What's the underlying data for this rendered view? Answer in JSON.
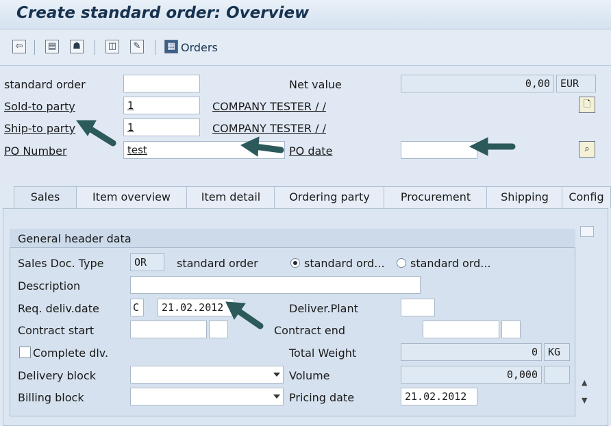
{
  "title": "Create standard order: Overview",
  "toolbar": {
    "icons": [
      "display-doc-icon",
      "header-icon",
      "partner-icon",
      "item-icon",
      "configure-icon",
      "orders-grid-icon"
    ],
    "orders_label": "Orders"
  },
  "header": {
    "standard_order_label": "standard order",
    "standard_order_value": "",
    "net_value_label": "Net value",
    "net_value": "0,00",
    "currency": "EUR",
    "sold_to_label": "Sold-to party",
    "sold_to_value": "1",
    "sold_to_name": "COMPANY TESTER / /",
    "ship_to_label": "Ship-to party",
    "ship_to_value": "1",
    "ship_to_name": "COMPANY TESTER / /",
    "po_number_label": "PO Number",
    "po_number_value": "test",
    "po_date_label": "PO date",
    "po_date_value": ""
  },
  "tabs": [
    {
      "label": "Sales",
      "active": true
    },
    {
      "label": "Item overview"
    },
    {
      "label": "Item detail"
    },
    {
      "label": "Ordering party"
    },
    {
      "label": "Procurement"
    },
    {
      "label": "Shipping"
    },
    {
      "label": "Config"
    }
  ],
  "sales": {
    "group_title": "General header data",
    "doc_type_label": "Sales Doc. Type",
    "doc_type_value": "OR",
    "doc_type_text": "standard order",
    "radio1_label": "standard ord...",
    "radio2_label": "standard ord...",
    "description_label": "Description",
    "description_value": "",
    "req_deliv_label": "Req. deliv.date",
    "req_deliv_prefix": "C",
    "req_deliv_value": "21.02.2012",
    "deliver_plant_label": "Deliver.Plant",
    "deliver_plant_value": "",
    "contract_start_label": "Contract start",
    "contract_end_label": "Contract end",
    "complete_dlv_label": "Complete dlv.",
    "total_weight_label": "Total Weight",
    "total_weight_value": "0",
    "weight_unit": "KG",
    "delivery_block_label": "Delivery block",
    "volume_label": "Volume",
    "volume_value": "0,000",
    "billing_block_label": "Billing block",
    "pricing_date_label": "Pricing date",
    "pricing_date_value": "21.02.2012"
  },
  "colors": {
    "arrow": "#2c5a5a",
    "title": "#16324f"
  }
}
